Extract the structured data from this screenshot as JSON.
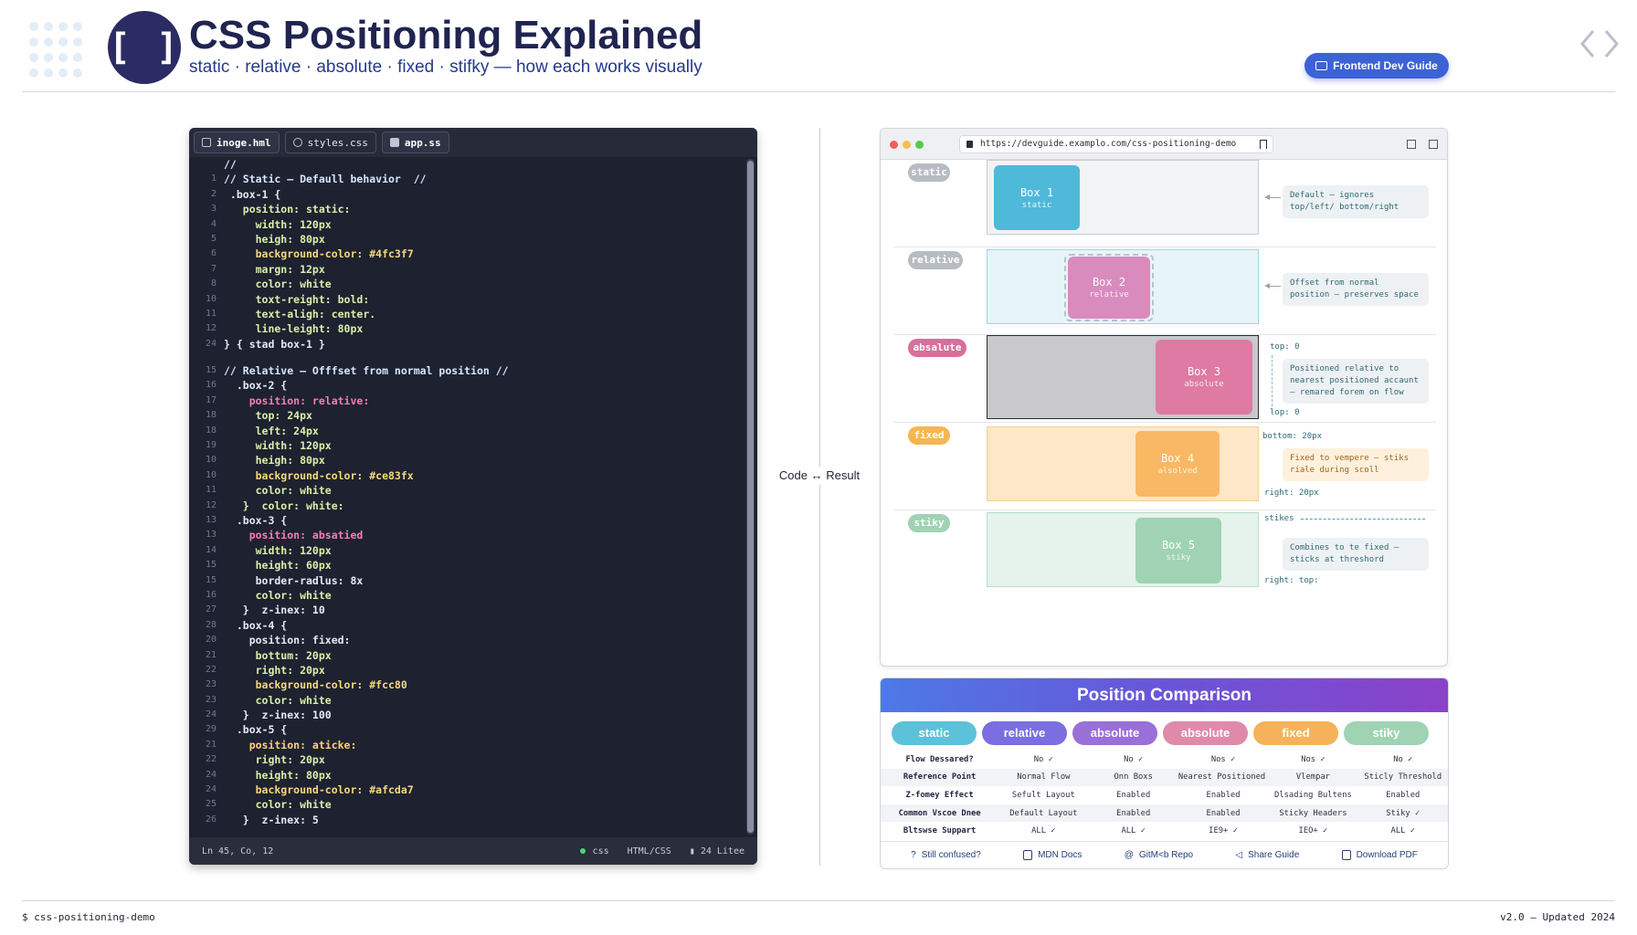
{
  "header": {
    "logo_text": "[ ]",
    "title": "CSS Positioning Explained",
    "subtitle": "static · relative · absolute · fixed · stifky — how each works visually",
    "guide_button": "Frontend Dev Guide"
  },
  "editor": {
    "tabs": [
      {
        "label": "inoge.hml",
        "icon": "file-icon"
      },
      {
        "label": "styles.css",
        "icon": "globe-icon"
      },
      {
        "label": "app.ss",
        "icon": "square-file-icon"
      }
    ],
    "lines": [
      {
        "n": "",
        "t": "//"
      },
      {
        "n": "1",
        "t": "// Static — Defaull behavior  //"
      },
      {
        "n": "2",
        "t": " .box-1 {"
      },
      {
        "n": "3",
        "t": "   position: static:"
      },
      {
        "n": "4",
        "t": "     width: 120px"
      },
      {
        "n": "5",
        "t": "     heigh: 80px"
      },
      {
        "n": "6",
        "t": "     background-color: #4fc3f7"
      },
      {
        "n": "7",
        "t": "     margn: 12px"
      },
      {
        "n": "8",
        "t": "     color: white"
      },
      {
        "n": "10",
        "t": "     toxt-reight: bold:"
      },
      {
        "n": "11",
        "t": "     text-aligh: center."
      },
      {
        "n": "12",
        "t": "     line-leight: 80px"
      },
      {
        "n": "24",
        "t": "} { stad box-1 }"
      },
      {
        "n": "",
        "t": ""
      },
      {
        "n": "15",
        "t": "// Relative — Offfset from normal position //"
      },
      {
        "n": "16",
        "t": "  .box-2 {"
      },
      {
        "n": "17",
        "t": "    position: relative:"
      },
      {
        "n": "18",
        "t": "     top: 24px"
      },
      {
        "n": "18",
        "t": "     left: 24px"
      },
      {
        "n": "19",
        "t": "     width: 120px"
      },
      {
        "n": "10",
        "t": "     heigh: 80px"
      },
      {
        "n": "10",
        "t": "     background-color: #ce83fx"
      },
      {
        "n": "11",
        "t": "     color: white"
      },
      {
        "n": "12",
        "t": "   }  color: white:"
      },
      {
        "n": "13",
        "t": "  .box-3 {"
      },
      {
        "n": "13",
        "t": "    position: absatied"
      },
      {
        "n": "14",
        "t": "     width: 120px"
      },
      {
        "n": "15",
        "t": "     height: 60px"
      },
      {
        "n": "15",
        "t": "     border-radlus: 8x"
      },
      {
        "n": "16",
        "t": "     color: white"
      },
      {
        "n": "27",
        "t": "   }  z-inex: 10"
      },
      {
        "n": "28",
        "t": "  .box-4 {"
      },
      {
        "n": "20",
        "t": "    position: fixed:"
      },
      {
        "n": "21",
        "t": "     bottum: 20px"
      },
      {
        "n": "22",
        "t": "     right: 20px"
      },
      {
        "n": "23",
        "t": "     background-color: #fcc80"
      },
      {
        "n": "23",
        "t": "     color: white"
      },
      {
        "n": "24",
        "t": "   }  z-inex: 100"
      },
      {
        "n": "29",
        "t": "  .box-5 {"
      },
      {
        "n": "21",
        "t": "    position: aticke:"
      },
      {
        "n": "22",
        "t": "     right: 20px"
      },
      {
        "n": "24",
        "t": "     height: 80px"
      },
      {
        "n": "24",
        "t": "     background-color: #afcda7"
      },
      {
        "n": "25",
        "t": "     color: white"
      },
      {
        "n": "26",
        "t": "   }  z-inex: 5"
      }
    ],
    "status": {
      "position": "Ln 45, Co, 12",
      "lang": "css",
      "mode": "HTML/CSS",
      "lines": "24 Litee"
    }
  },
  "divider_label": "Code ↔ Result",
  "browser": {
    "url": "https://devguide.examplo.com/css-positioning-demo",
    "sections": [
      {
        "pill": "static",
        "box_title": "Box 1",
        "box_sub": "static",
        "note": "Default — ignores top/left/ bottom/right",
        "color": "#4fb9d9"
      },
      {
        "pill": "relative",
        "box_title": "Box 2",
        "box_sub": "relative",
        "note": "Offset from normal position — preserves space",
        "color": "#d98bbd"
      },
      {
        "pill": "absalute",
        "box_title": "Box 3",
        "box_sub": "absolute",
        "note": "Positioned relative to nearest positioned accaunt — remared forem on flow",
        "color": "#de7aa3",
        "label_top": "top: 0",
        "label_bottom": "lop: 0"
      },
      {
        "pill": "fixed",
        "box_title": "Box 4",
        "box_sub": "alsolved",
        "note": "Fixed to vempere — stiks riale during scoll",
        "color": "#f9b863",
        "label_top": "bottom: 20px",
        "label_bottom": "right: 20px"
      },
      {
        "pill": "stiky",
        "box_title": "Box 5",
        "box_sub": "stiky",
        "note": "Combines to te fixed — sticks at threshord",
        "color": "#9fd3b3",
        "label_top": "stikes",
        "label_bottom": "right: top:"
      }
    ]
  },
  "comparison": {
    "title": "Position Comparison",
    "columns": [
      {
        "label": "static",
        "color": "#5cc2d9"
      },
      {
        "label": "relative",
        "color": "#7a6ee0"
      },
      {
        "label": "absolute",
        "color": "#9a6fd8"
      },
      {
        "label": "absolute",
        "color": "#e08aaa"
      },
      {
        "label": "fixed",
        "color": "#f5b25a"
      },
      {
        "label": "stiky",
        "color": "#9fd3b3"
      }
    ],
    "rows": [
      [
        "Flow Dessared?",
        "No ✓",
        "No ✓",
        "Nos ✓",
        "Nos ✓",
        "No ✓"
      ],
      [
        "Reference Point",
        "Normal Flow",
        "Onn Boxs",
        "Nearest Positioned accaunr",
        "Vlempar",
        "Sticly Threshold"
      ],
      [
        "Z-fomey Effect",
        "Sefult Layout",
        "Enabled",
        "Enabled",
        "Dlsading Bultens",
        "Enabled"
      ],
      [
        "Common Vscoe Dnee",
        "Default Layout",
        "Enabled",
        "Enabled",
        "Sticky Headers",
        "Stiky ✓"
      ],
      [
        "Bltswse Suppart",
        "ALL ✓",
        "ALL ✓",
        "IE9+ ✓",
        "IEO+ ✓",
        "ALL ✓"
      ]
    ],
    "footer": [
      "Still confused?",
      "MDN Docs",
      "GitM<b Repo",
      "Share Guide",
      "Download PDF"
    ]
  },
  "footer": {
    "left": "$   css-positioning-demo",
    "right": "v2.0 — Updated 2024"
  }
}
